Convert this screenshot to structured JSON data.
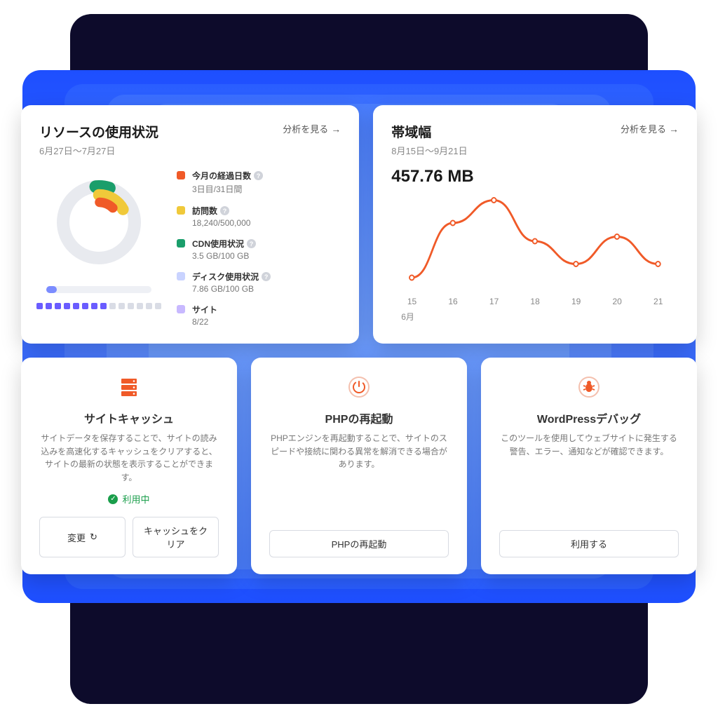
{
  "colors": {
    "orange": "#f05a28",
    "yellow": "#f0c93a",
    "green": "#1a9e6b",
    "blue": "#7b8cff",
    "purple": "#6a5cff"
  },
  "resource": {
    "title": "リソースの使用状況",
    "date_range": "6月27日～7月27日",
    "analytics_link": "分析を見る",
    "metrics": [
      {
        "color": "#f05a28",
        "label": "今月の経過日数",
        "value": "3日目/31日間",
        "help": true
      },
      {
        "color": "#f0c93a",
        "label": "訪問数",
        "value": "18,240/500,000",
        "help": true
      },
      {
        "color": "#1a9e6b",
        "label": "CDN使用状況",
        "value": "3.5 GB/100 GB",
        "help": true
      },
      {
        "color": "#c9d3ff",
        "label": "ディスク使用状況",
        "value": "7.86 GB/100 GB",
        "help": true
      },
      {
        "color": "#c8b9ff",
        "label": "サイト",
        "value": "8/22",
        "help": false
      }
    ],
    "sites_used": 8,
    "sites_total": 22
  },
  "bandwidth": {
    "title": "帯域幅",
    "date_range": "8月15日～9月21日",
    "analytics_link": "分析を見る",
    "value": "457.76 MB",
    "month_label": "6月"
  },
  "chart_data": {
    "type": "line",
    "title": "帯域幅",
    "xlabel": "6月",
    "ylabel": "",
    "x": [
      15,
      16,
      17,
      18,
      19,
      20,
      21
    ],
    "values": [
      10,
      70,
      95,
      50,
      25,
      55,
      25
    ],
    "ylim": [
      0,
      100
    ]
  },
  "tools": {
    "cache": {
      "title": "サイトキャッシュ",
      "desc": "サイトデータを保存することで、サイトの読み込みを高速化するキャッシュをクリアすると、サイトの最新の状態を表示することができます。",
      "status": "利用中",
      "btn_change": "変更",
      "btn_clear": "キャッシュをクリア"
    },
    "php": {
      "title": "PHPの再起動",
      "desc": "PHPエンジンを再起動することで、サイトのスピードや接続に関わる異常を解消できる場合があります。",
      "btn": "PHPの再起動"
    },
    "debug": {
      "title": "WordPressデバッグ",
      "desc": "このツールを使用してウェブサイトに発生する警告、エラー、通知などが確認できます。",
      "btn": "利用する"
    }
  }
}
